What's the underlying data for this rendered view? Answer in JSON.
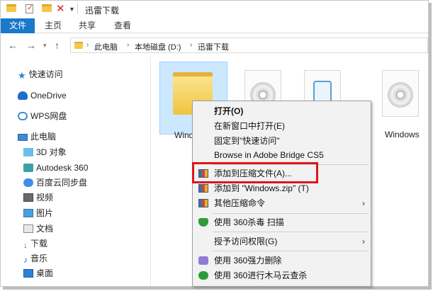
{
  "titlebar": {
    "title": "迅雷下载",
    "quick_access": [
      "folder-icon",
      "properties-icon",
      "folder-icon",
      "delete-icon",
      "customize-dropdown-icon"
    ]
  },
  "ribbon": {
    "tabs": [
      {
        "label": "文件",
        "active": true
      },
      {
        "label": "主页"
      },
      {
        "label": "共享"
      },
      {
        "label": "查看"
      }
    ]
  },
  "address": {
    "crumbs": [
      "此电脑",
      "本地磁盘 (D:)",
      "迅雷下载"
    ]
  },
  "sidebar": {
    "items": [
      {
        "label": "快速访问",
        "icon": "star-icon"
      },
      {
        "label": "OneDrive",
        "icon": "onedrive-icon"
      },
      {
        "label": "WPS网盘",
        "icon": "wps-cloud-icon"
      },
      {
        "label": "此电脑",
        "icon": "computer-icon"
      },
      {
        "label": "3D 对象",
        "icon": "3d-objects-icon"
      },
      {
        "label": "Autodesk 360",
        "icon": "autodesk-icon"
      },
      {
        "label": "百度云同步盘",
        "icon": "baidu-cloud-icon"
      },
      {
        "label": "视频",
        "icon": "video-icon"
      },
      {
        "label": "图片",
        "icon": "pictures-icon"
      },
      {
        "label": "文档",
        "icon": "documents-icon"
      },
      {
        "label": "下载",
        "icon": "downloads-icon"
      },
      {
        "label": "音乐",
        "icon": "music-icon"
      },
      {
        "label": "桌面",
        "icon": "desktop-icon"
      }
    ]
  },
  "files": [
    {
      "label": "Windo",
      "type": "folder",
      "selected": true
    },
    {
      "label": "",
      "type": "disc-image"
    },
    {
      "label": "",
      "type": "installer"
    },
    {
      "label": "Windows",
      "type": "disc-image"
    }
  ],
  "context_menu": {
    "items": [
      {
        "label": "打开(O)",
        "bold": true
      },
      {
        "label": "在新窗口中打开(E)"
      },
      {
        "label": "固定到\"快速访问\""
      },
      {
        "label": "Browse in Adobe Bridge CS5"
      },
      {
        "label": "添加到压缩文件(A)...",
        "icon": "zip-archive-icon",
        "highlighted": true
      },
      {
        "label": "添加到 \"Windows.zip\" (T)",
        "icon": "zip-archive-icon"
      },
      {
        "label": "其他压缩命令",
        "icon": "zip-archive-icon",
        "submenu": true
      },
      {
        "label": "使用 360杀毒 扫描",
        "icon": "shield-icon"
      },
      {
        "label": "授予访问权限(G)",
        "submenu": true
      },
      {
        "label": "使用 360强力删除",
        "icon": "shredder-icon"
      },
      {
        "label": "使用 360进行木马云查杀",
        "icon": "trojan-scan-icon"
      }
    ],
    "highlight_color": "#e0141b"
  },
  "colors": {
    "accent": "#1979ca",
    "selection": "#cce8ff",
    "menu_background": "#f2f2f2"
  }
}
